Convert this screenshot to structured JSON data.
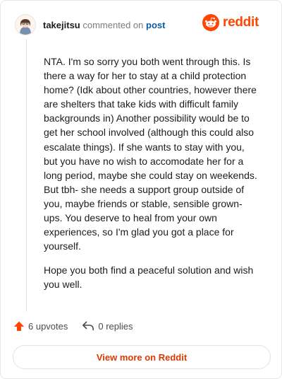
{
  "comment": {
    "username": "takejitsu",
    "action_text": "commented on",
    "post_link_label": "post",
    "body": [
      "NTA. I'm so sorry you both went through this. Is there a way for her to stay at a child protection home? (Idk about other countries, however there are shelters that take kids with difficult family backgrounds in) Another possibility would be to get her school involved (although this could also escalate things). If she wants to stay with you, but you have no wish to accomodate her for a long period, maybe she could stay on weekends. But tbh- she needs a support group outside of you, maybe friends or stable, sensible grown-ups. You deserve to heal from your own experiences, so I'm glad you got a place for yourself.",
      "Hope you both find a peaceful solution and wish you well."
    ],
    "upvotes_label": "6 upvotes",
    "replies_label": "0 replies"
  },
  "brand": {
    "wordmark": "reddit",
    "color": "#ff4500"
  },
  "footer": {
    "view_more_label": "View more on Reddit"
  },
  "icons": {
    "avatar": "avatar-image",
    "logo": "reddit-snoo-icon",
    "upvote": "upvote-arrow-icon",
    "reply": "reply-arrow-icon"
  }
}
